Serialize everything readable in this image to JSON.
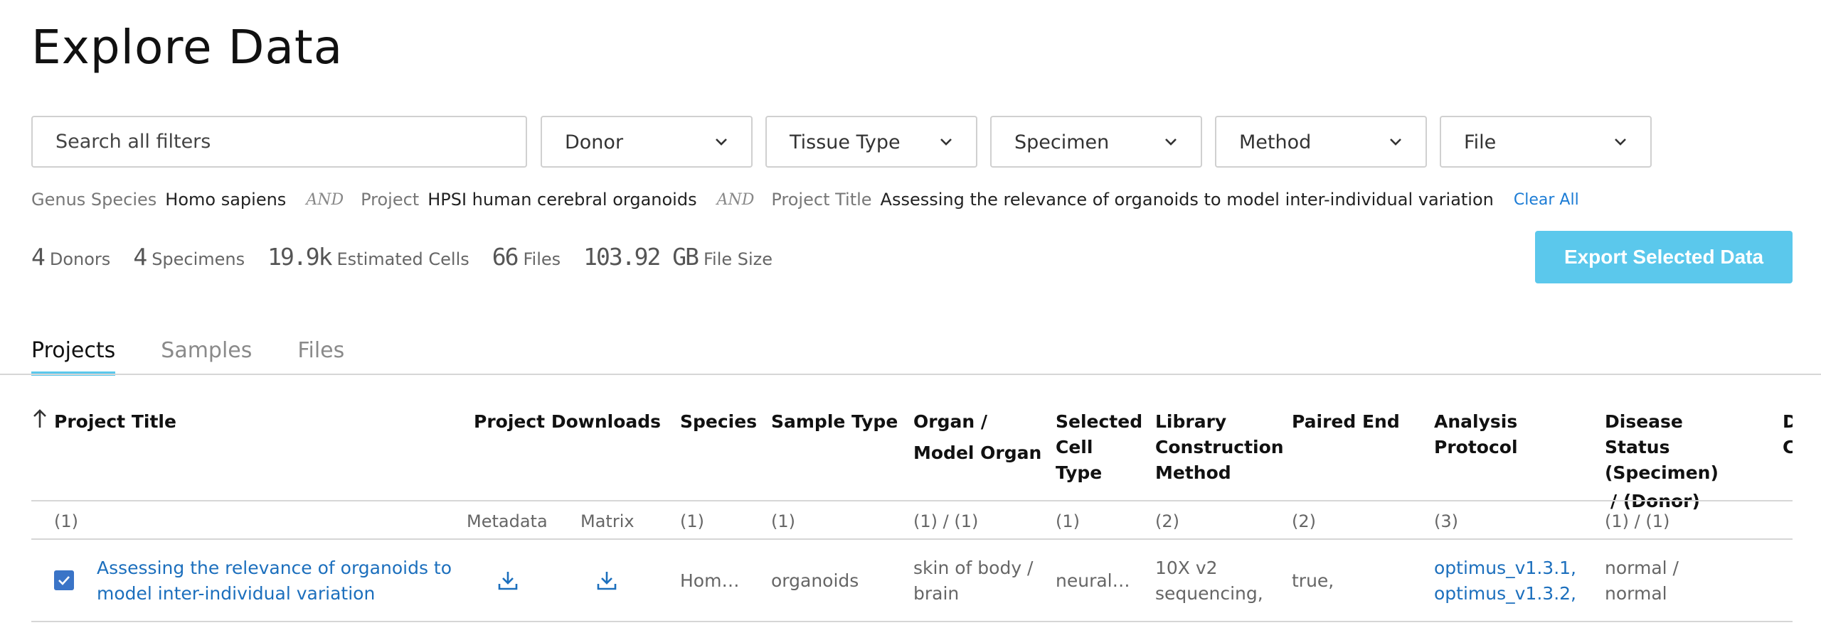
{
  "page": {
    "title": "Explore Data"
  },
  "search": {
    "placeholder": "Search all filters"
  },
  "filters": [
    "Donor",
    "Tissue Type",
    "Specimen",
    "Method",
    "File"
  ],
  "selected_terms": [
    {
      "facet": "Genus Species",
      "value": "Homo sapiens"
    },
    {
      "facet": "Project",
      "value": "HPSI human cerebral organoids"
    },
    {
      "facet": "Project Title",
      "value": "Assessing the relevance of organoids to model inter-individual variation"
    }
  ],
  "and_label": "AND",
  "clear_all": "Clear All",
  "summary": [
    {
      "value": "4",
      "label": "Donors"
    },
    {
      "value": "4",
      "label": "Specimens"
    },
    {
      "value": "19.9k",
      "label": "Estimated Cells"
    },
    {
      "value": "66",
      "label": "Files"
    },
    {
      "value": "103.92 GB",
      "label": "File Size"
    }
  ],
  "export_button": "Export Selected Data",
  "tabs": [
    {
      "label": "Projects",
      "active": true
    },
    {
      "label": "Samples",
      "active": false
    },
    {
      "label": "Files",
      "active": false
    }
  ],
  "table": {
    "columns": {
      "project_title": "Project Title",
      "project_downloads": "Project Downloads",
      "species": "Species",
      "sample_type": "Sample Type",
      "organ": "Organ /",
      "organ2": "Model Organ",
      "selected_cell_type": "Selected Cell Type",
      "library": "Library Construction Method",
      "paired_end": "Paired End",
      "analysis_protocol": "Analysis Protocol",
      "disease_status": "Disease Status (Specimen)",
      "disease_status2": "/ (Donor)",
      "truncated": "D C"
    },
    "counts": {
      "project_title": "(1)",
      "metadata": "Metadata",
      "matrix": "Matrix",
      "species": "(1)",
      "sample_type": "(1)",
      "organ": "(1) / (1)",
      "selected_cell_type": "(1)",
      "library": "(2)",
      "paired_end": "(2)",
      "analysis_protocol": "(3)",
      "disease_status": "(1) / (1)"
    },
    "rows": [
      {
        "selected": true,
        "project_title": "Assessing the relevance of organoids to model inter-individual variation",
        "species": "Hom…",
        "sample_type": "organoids",
        "organ_l1": "skin of body /",
        "organ_l2": "brain",
        "selected_cell_type": "neural…",
        "library_l1": "10X v2",
        "library_l2": "sequencing,",
        "paired_end": "true,",
        "analysis_l1": "optimus_v1.3.1,",
        "analysis_l2": "optimus_v1.3.2,",
        "disease_l1": "normal /",
        "disease_l2": "normal"
      }
    ]
  },
  "colors": {
    "accent": "#5bc8ec",
    "link": "#1c6fbd",
    "checkbox": "#3a74c7"
  },
  "icons": {
    "sort": "arrow-up-icon",
    "download": "download-icon",
    "chevron": "chevron-down-icon",
    "check": "check-icon"
  }
}
